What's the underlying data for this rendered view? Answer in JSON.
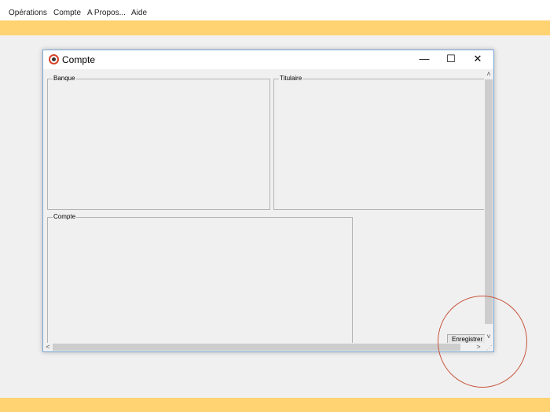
{
  "menubar": {
    "items": [
      {
        "label": "Opérations"
      },
      {
        "label": "Compte"
      },
      {
        "label": "A Propos..."
      },
      {
        "label": "Aide"
      }
    ]
  },
  "window": {
    "title": "Compte",
    "controls": {
      "minimize": "—",
      "maximize": "☐",
      "close": "✕"
    },
    "groups": {
      "banque": "Banque",
      "titulaire": "Titulaire",
      "compte": "Compte"
    },
    "save_button": "Enregistrer",
    "scroll_glyphs": {
      "up": "˄",
      "down": "˅",
      "left": "<",
      "right": ">",
      "grip": "⋰"
    }
  },
  "colors": {
    "accent_band": "#ffd272",
    "highlight_circle": "#c8553d",
    "window_border": "#7aa7d6"
  }
}
